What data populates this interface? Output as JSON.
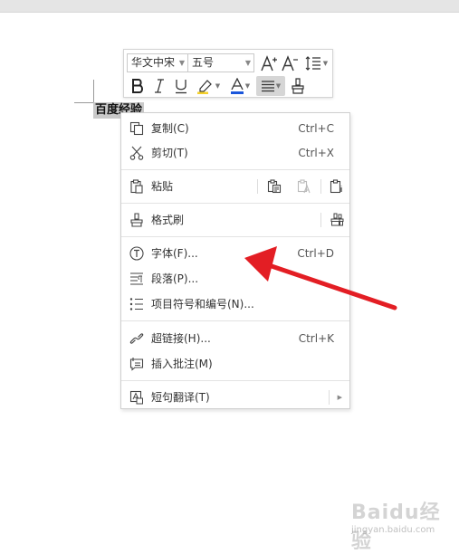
{
  "document": {
    "selected_text": "百度经验"
  },
  "toolbar": {
    "font_name": "华文中宋",
    "font_size": "五号",
    "buttons": [
      {
        "name": "grow-font-icon"
      },
      {
        "name": "shrink-font-icon"
      },
      {
        "name": "line-spacing-icon"
      },
      {
        "name": "bold-icon"
      },
      {
        "name": "italic-icon"
      },
      {
        "name": "underline-icon"
      },
      {
        "name": "highlight-icon"
      },
      {
        "name": "font-color-icon"
      },
      {
        "name": "align-icon",
        "active": true
      },
      {
        "name": "format-painter-icon"
      }
    ],
    "font_color_accent": "#1a56db",
    "highlight_accent": "#f4d02a"
  },
  "context_menu": {
    "items": [
      {
        "icon": "copy-icon",
        "label": "复制(C)",
        "shortcut": "Ctrl+C"
      },
      {
        "icon": "cut-icon",
        "label": "剪切(T)",
        "shortcut": "Ctrl+X"
      },
      {
        "icon": "paste-icon",
        "label": "粘贴",
        "paste_options": [
          "paste-keep-format-icon",
          "paste-text-only-icon",
          "paste-special-icon"
        ]
      },
      {
        "icon": "format-painter-icon",
        "label": "格式刷"
      },
      {
        "icon": "font-icon",
        "label": "字体(F)...",
        "shortcut": "Ctrl+D"
      },
      {
        "icon": "paragraph-icon",
        "label": "段落(P)..."
      },
      {
        "icon": "bullets-icon",
        "label": "项目符号和编号(N)..."
      },
      {
        "icon": "hyperlink-icon",
        "label": "超链接(H)...",
        "shortcut": "Ctrl+K"
      },
      {
        "icon": "comment-icon",
        "label": "插入批注(M)"
      },
      {
        "icon": "translate-icon",
        "label": "短句翻译(T)",
        "has_submenu": true
      }
    ]
  },
  "annotation": {
    "arrow_color": "#e31e24"
  },
  "watermark": {
    "logo": "Baidu经验",
    "url": "jingyan.baidu.com"
  }
}
